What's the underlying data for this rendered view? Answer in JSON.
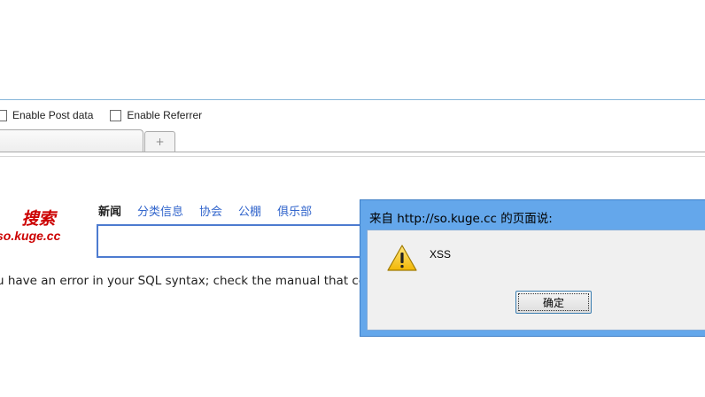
{
  "toolbar": {
    "enable_post_label": "Enable Post data",
    "enable_referrer_label": "Enable Referrer"
  },
  "tabs": {
    "new_tab_symbol": "+"
  },
  "page": {
    "logo_cn": "搜索",
    "logo_en": "so.kuge.cc",
    "nav_items": [
      "新闻",
      "分类信息",
      "协会",
      "公棚",
      "俱乐部"
    ],
    "error_text": "u have an error in your SQL syntax; check the manual that cor"
  },
  "dialog": {
    "title": "来自 http://so.kuge.cc 的页面说:",
    "message": "XSS",
    "ok_label": "确定",
    "icon": "warning-icon"
  },
  "colors": {
    "dialog_frame": "#64a7eb",
    "logo_red": "#cc0000",
    "nav_link": "#3366cc",
    "search_border": "#4d7bd0"
  }
}
